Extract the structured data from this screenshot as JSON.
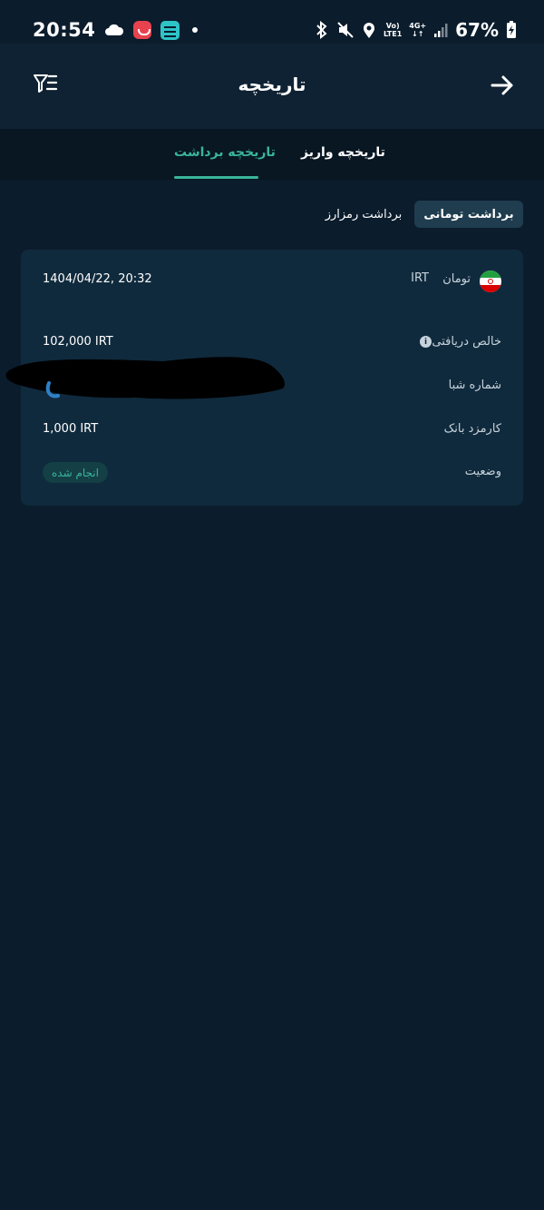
{
  "status_bar": {
    "time": "20:54",
    "battery": "67%",
    "network_top": "Vo)",
    "network_bottom": "LTE1",
    "net_type": "4G+"
  },
  "header": {
    "title": "تاریخچه"
  },
  "tabs": [
    {
      "label": "تاریخچه واریز",
      "active": false
    },
    {
      "label": "تاریخچه برداشت",
      "active": true
    }
  ],
  "sub_tabs": [
    {
      "label": "برداشت تومانی",
      "active": true
    },
    {
      "label": "برداشت رمزارز",
      "active": false
    }
  ],
  "transaction": {
    "datetime": "1404/04/22, 20:32",
    "currency_name": "تومان",
    "currency_code": "IRT",
    "rows": [
      {
        "label": "خالص دریافتی",
        "value": "102,000 IRT"
      },
      {
        "label": "شماره شبا",
        "value": ""
      },
      {
        "label": "کارمزد بانک",
        "value": "1,000 IRT"
      },
      {
        "label": "وضعیت",
        "value": "انجام شده"
      }
    ]
  },
  "colors": {
    "background": "#0b1c2c",
    "header": "#0f2233",
    "card": "#102a3d",
    "accent": "#3ab59a"
  }
}
